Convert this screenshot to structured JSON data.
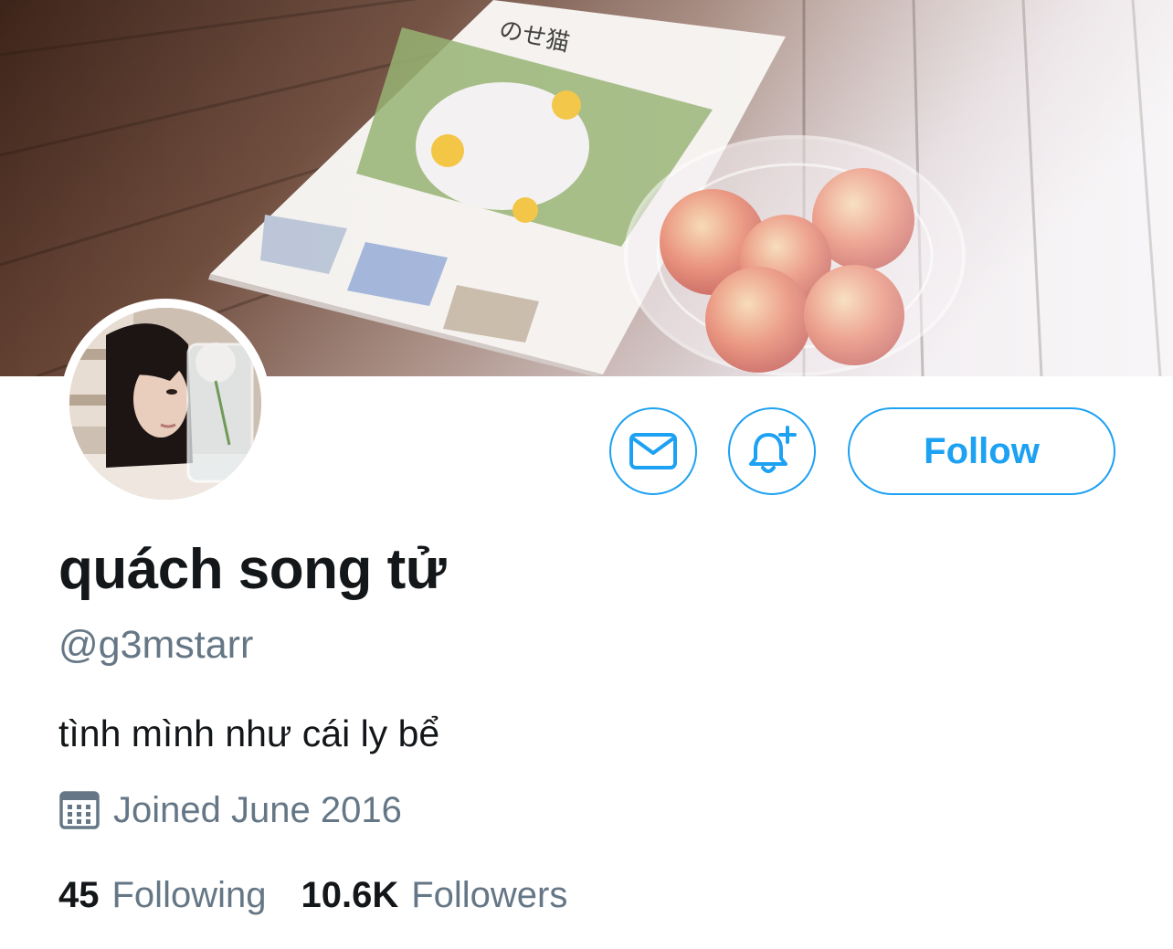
{
  "profile": {
    "display_name": "quách song tử",
    "handle": "@g3mstarr",
    "bio": "tình mình như cái ly bể",
    "joined": "Joined June 2016"
  },
  "actions": {
    "follow_label": "Follow",
    "message_icon": "envelope-icon",
    "notify_icon": "bell-plus-icon"
  },
  "stats": {
    "following_count": "45",
    "following_label": "Following",
    "followers_count": "10.6K",
    "followers_label": "Followers"
  },
  "colors": {
    "accent": "#1da1f2",
    "text_primary": "#14171a",
    "text_secondary": "#657786"
  }
}
